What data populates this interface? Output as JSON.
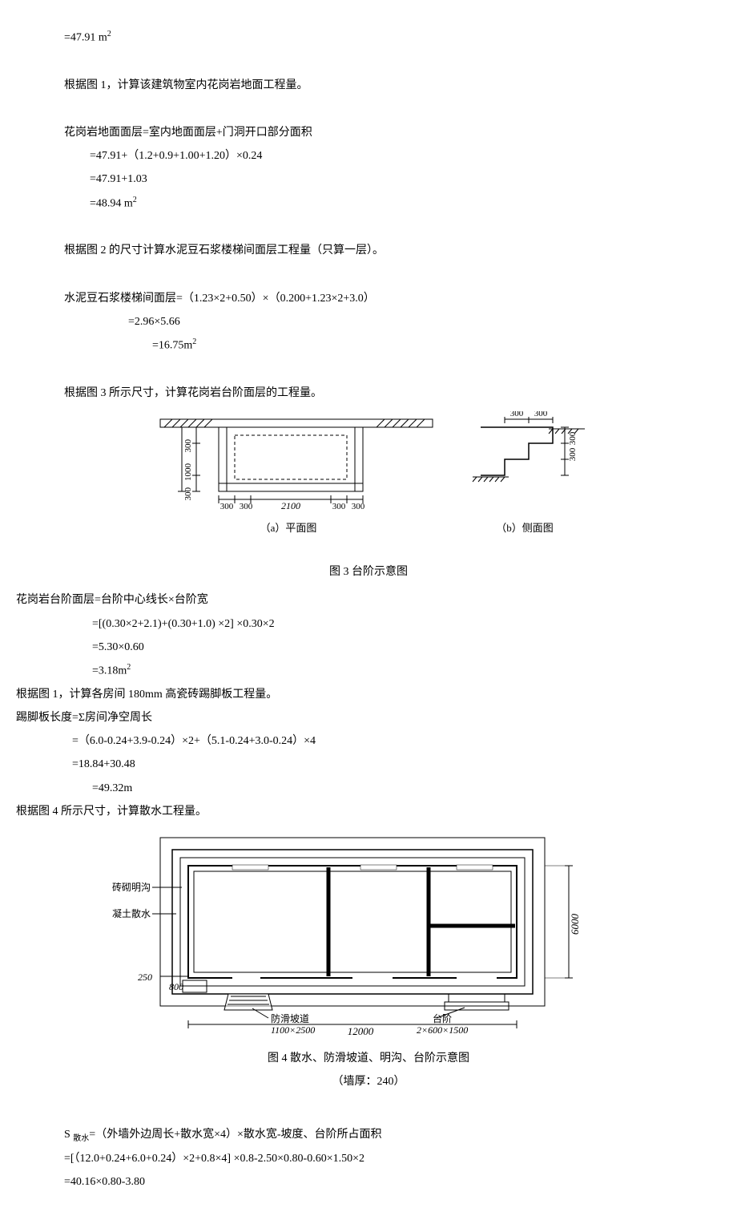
{
  "line1": "=47.91 m",
  "sup_m2": "2",
  "para1": "根据图 1，计算该建筑物室内花岗岩地面工程量。",
  "para2_l1": "花岗岩地面面层=室内地面面层+门洞开口部分面积",
  "para2_l2": "=47.91+（1.2+0.9+1.00+1.20）×0.24",
  "para2_l3": "=47.91+1.03",
  "para2_l4": "=48.94 m",
  "para3": "根据图 2 的尺寸计算水泥豆石浆楼梯间面层工程量（只算一层）。",
  "para4_l1": "水泥豆石浆楼梯间面层=（1.23×2+0.50）×（0.200+1.23×2+3.0）",
  "para4_l2": "=2.96×5.66",
  "para4_l3": "=16.75m",
  "para5": "根据图 3 所示尺寸，计算花岗岩台阶面层的工程量。",
  "fig3": {
    "caption": "图 3 台阶示意图",
    "label_a": "（a）平面图",
    "label_b": "（b）侧面图",
    "dim_300_1": "300",
    "dim_300_2": "300",
    "dim_300_3": "300",
    "dim_300_4": "300",
    "dim_300_5": "300",
    "dim_300_6": "300",
    "dim_1000": "1000",
    "dim_2100": "2100",
    "dim_300_v1": "300",
    "dim_300_v2": "300",
    "dim_300_v3": "300",
    "dim_300_v4": "300"
  },
  "para6_l1": "花岗岩台阶面层=台阶中心线长×台阶宽",
  "para6_l2": "=[(0.30×2+2.1)+(0.30+1.0) ×2]  ×0.30×2",
  "para6_l3": "=5.30×0.60",
  "para6_l4": "=3.18m",
  "para7": "根据图 1，计算各房间 180mm 高瓷砖踢脚板工程量。",
  "para8_l1": "踢脚板长度=Σ房间净空周长",
  "para8_l2": "=（6.0-0.24+3.9-0.24）×2+（5.1-0.24+3.0-0.24）×4",
  "para8_l3": "=18.84+30.48",
  "para8_l4": "=49.32m",
  "para9": "根据图 4 所示尺寸，计算散水工程量。",
  "fig4": {
    "caption": "图 4 散水、防滑坡道、明沟、台阶示意图",
    "subcaption": "（墙厚：240）",
    "label_brick": "砖砌明沟",
    "label_concrete": "混凝土散水",
    "label_ramp": "防滑坡道",
    "label_ramp_dim": "1100×2500",
    "label_step": "台阶",
    "label_step_dim": "2×600×1500",
    "dim_250": "250",
    "dim_800": "800",
    "dim_12000": "12000",
    "dim_6000": "6000"
  },
  "para10_l1_a": "S ",
  "para10_l1_sub": "散水",
  "para10_l1_b": "=（外墙外边周长+散水宽×4）×散水宽-坡度、台阶所占面积",
  "para10_l2": "=[（12.0+0.24+6.0+0.24）×2+0.8×4]  ×0.8-2.50×0.80-0.60×1.50×2",
  "para10_l3": "=40.16×0.80-3.80"
}
